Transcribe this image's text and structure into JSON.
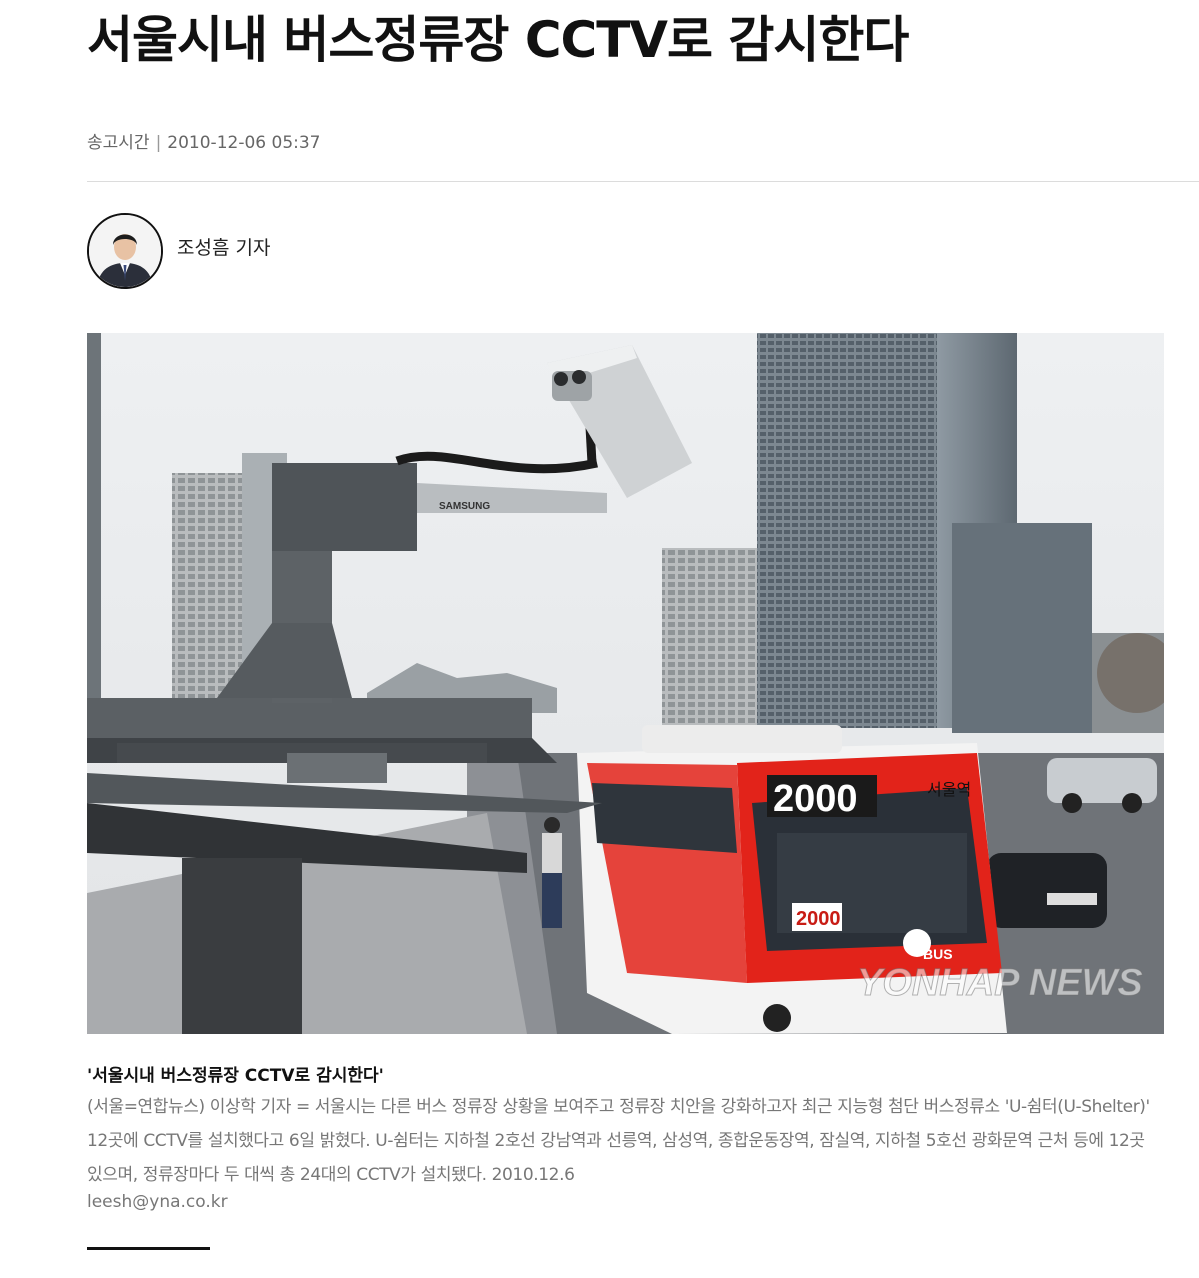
{
  "article": {
    "title": "서울시내 버스정류장 CCTV로 감시한다",
    "meta_label": "송고시간",
    "meta_separator": "|",
    "published": "2010-12-06 05:37",
    "reporter": "조성흠 기자"
  },
  "photo": {
    "watermark": "YONHAP NEWS",
    "camera_brand": "SAMSUNG",
    "bus_number": "2000",
    "bus_destination": "서울역",
    "bus_brand": "BUS"
  },
  "caption": {
    "title": "'서울시내 버스정류장 CCTV로 감시한다'",
    "body": "(서울=연합뉴스) 이상학 기자 = 서울시는 다른 버스 정류장 상황을 보여주고 정류장 치안을 강화하고자 최근 지능형 첨단 버스정류소 'U-쉼터(U-Shelter)' 12곳에 CCTV를 설치했다고 6일 밝혔다. U-쉼터는 지하철 2호선 강남역과 선릉역, 삼성역, 종합운동장역, 잠실역, 지하철 5호선 광화문역 근처 등에 12곳 있으며, 정류장마다 두 대씩 총 24대의 CCTV가 설치됐다. 2010.12.6",
    "email": "leesh@yna.co.kr"
  }
}
